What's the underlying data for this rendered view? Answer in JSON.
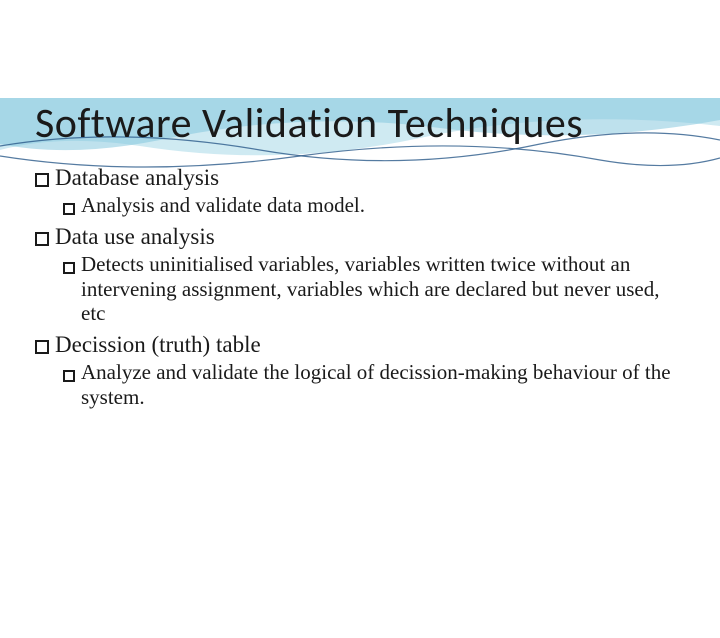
{
  "title": "Software Validation Techniques",
  "items": [
    {
      "label": "Database analysis",
      "sub": [
        "Analysis and validate data model."
      ]
    },
    {
      "label": "Data use analysis",
      "sub": [
        "Detects uninitialised   variables, variables written twice without an  intervening assignment, variables which are declared but never used, etc"
      ]
    },
    {
      "label": "Decission (truth) table",
      "sub": [
        "Analyze and validate the logical of decission-making behaviour of the system."
      ]
    }
  ]
}
